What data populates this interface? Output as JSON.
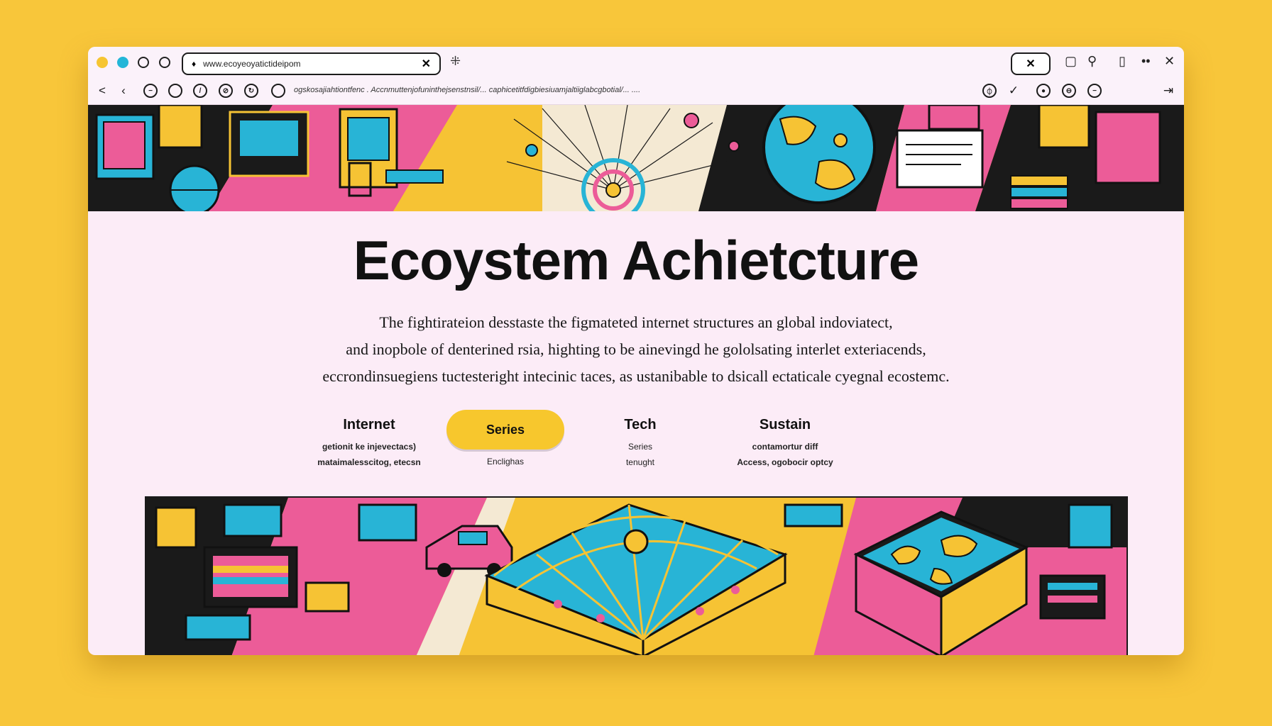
{
  "browser": {
    "tab_title": "www.ecoyeoyatictideipom",
    "url": "ogskosajiahtiontfenc . Accnmuttenjofuninthejsenstnsil/... caphicetitfdigbiesiuamjaltiiglabcgbotial/... ...."
  },
  "hero": {
    "title": "Ecoystem Achietcture",
    "description": [
      "The fightirateion desstaste the figmateted internet structures an global indoviatect,",
      "and inopbole of denterined rsia,  highting to  be ainevingd he gololsating interlet exteriacends,",
      "eccrondinsuegiens tuctesteright intecinic taces, as ustanibable to dsicall ectaticale cyegnal ecostemc."
    ]
  },
  "features": [
    {
      "title": "Internet",
      "lines": [
        "getionit ke injevectacs)",
        "mataimalesscitog, etecsn"
      ]
    },
    {
      "button": "Series",
      "lines": [
        "Enclighas"
      ]
    },
    {
      "title": "Tech",
      "lines": [
        "Series",
        "tenught"
      ]
    },
    {
      "title": "Sustain",
      "lines": [
        "contamortur diff",
        "Access, ogobocir optcy"
      ]
    }
  ],
  "colors": {
    "background": "#f8c63a",
    "page": "#fcecf7",
    "accent_yellow": "#f7c72d",
    "accent_pink": "#ec5c98",
    "accent_cyan": "#28b4d6"
  }
}
